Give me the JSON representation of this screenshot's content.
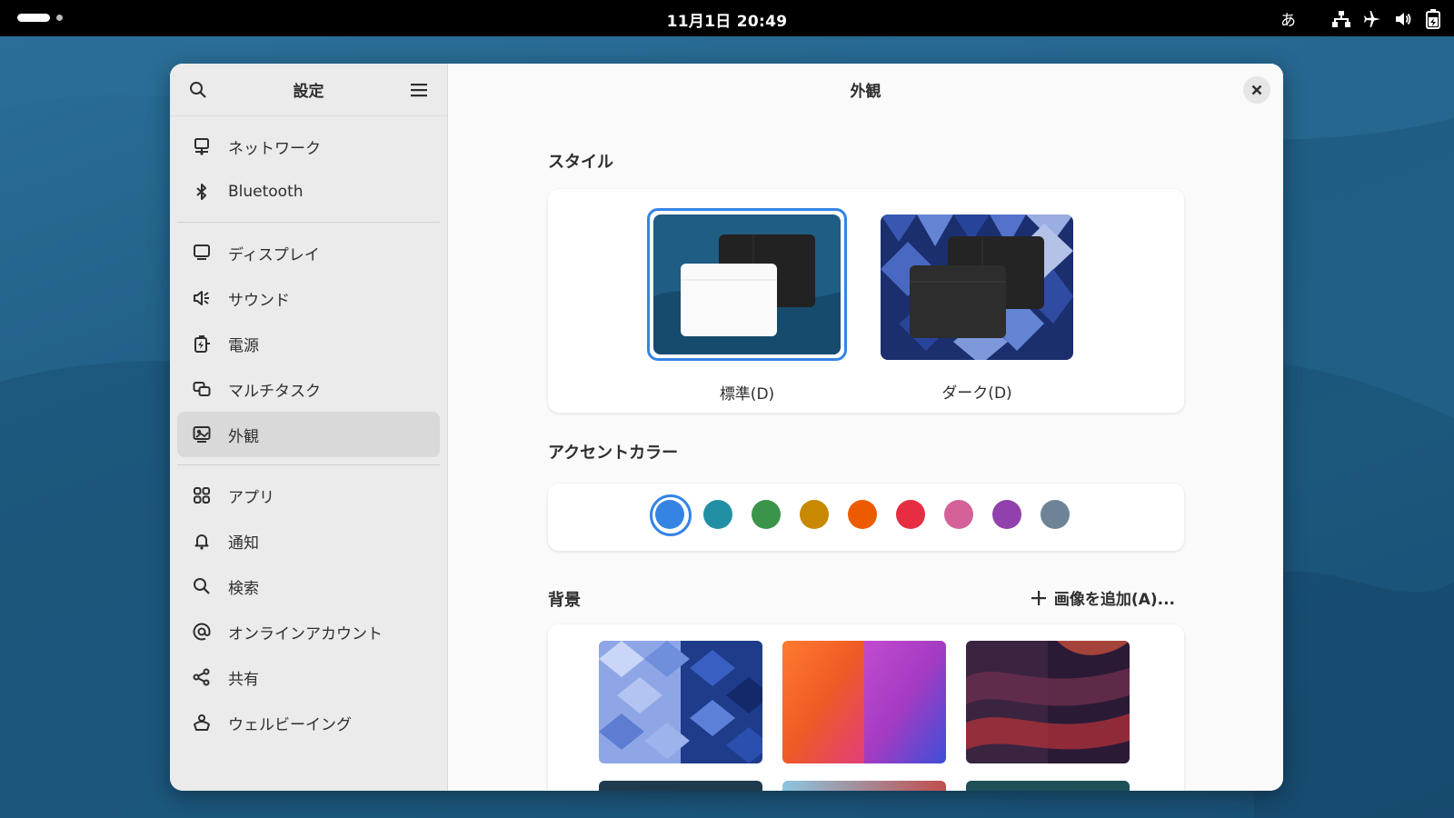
{
  "topbar": {
    "clock": "11月1日  20:49",
    "ime": "あ",
    "tray_icons": [
      "network-wired-icon",
      "airplane-mode-icon",
      "volume-icon",
      "battery-charging-icon"
    ]
  },
  "sidebar": {
    "title": "設定",
    "items": [
      {
        "label": "ネットワーク",
        "icon": "network-icon"
      },
      {
        "label": "Bluetooth",
        "icon": "bluetooth-icon"
      },
      {
        "label": "ディスプレイ",
        "icon": "display-icon"
      },
      {
        "label": "サウンド",
        "icon": "sound-icon"
      },
      {
        "label": "電源",
        "icon": "power-icon"
      },
      {
        "label": "マルチタスク",
        "icon": "multitasking-icon"
      },
      {
        "label": "外観",
        "icon": "appearance-icon",
        "active": true
      },
      {
        "label": "アプリ",
        "icon": "apps-icon"
      },
      {
        "label": "通知",
        "icon": "bell-icon"
      },
      {
        "label": "検索",
        "icon": "search-icon"
      },
      {
        "label": "オンラインアカウント",
        "icon": "at-icon"
      },
      {
        "label": "共有",
        "icon": "share-icon"
      },
      {
        "label": "ウェルビーイング",
        "icon": "wellbeing-icon"
      }
    ]
  },
  "main": {
    "title": "外観",
    "style": {
      "label": "スタイル",
      "options": [
        {
          "label": "標準(D)",
          "selected": true
        },
        {
          "label": "ダーク(D)",
          "selected": false
        }
      ]
    },
    "accent": {
      "label": "アクセントカラー",
      "colors": [
        "#3584e4",
        "#2190a4",
        "#3a944a",
        "#c88800",
        "#ed5b00",
        "#e62d42",
        "#d56199",
        "#9141ac",
        "#6f8396"
      ],
      "selected_index": 0
    },
    "background": {
      "label": "背景",
      "add_label": "画像を追加(A)..."
    }
  }
}
